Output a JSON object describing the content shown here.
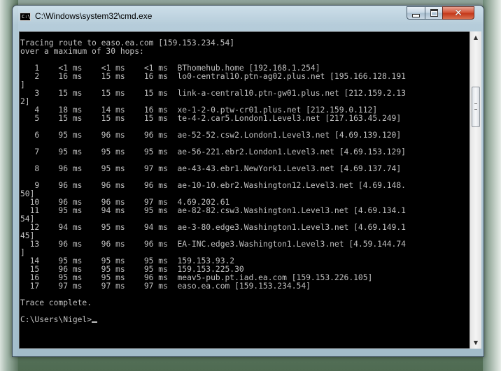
{
  "window": {
    "title": "C:\\Windows\\system32\\cmd.exe",
    "icon_text": "C:\\",
    "close_glyph": "✕"
  },
  "console": {
    "header_lines": [
      "Tracing route to easo.ea.com [159.153.234.54]",
      "over a maximum of 30 hops:"
    ],
    "hops": [
      {
        "n": "1",
        "t1": "<1 ms",
        "t2": "<1 ms",
        "t3": "<1 ms",
        "host": "BThomehub.home [192.168.1.254]"
      },
      {
        "n": "2",
        "t1": "16 ms",
        "t2": "15 ms",
        "t3": "16 ms",
        "host": "lo0-central10.ptn-ag02.plus.net [195.166.128.191",
        "cont": "]"
      },
      {
        "n": "3",
        "t1": "15 ms",
        "t2": "15 ms",
        "t3": "15 ms",
        "host": "link-a-central10.ptn-gw01.plus.net [212.159.2.13",
        "cont": "2]"
      },
      {
        "n": "4",
        "t1": "18 ms",
        "t2": "14 ms",
        "t3": "16 ms",
        "host": "xe-1-2-0.ptw-cr01.plus.net [212.159.0.112]"
      },
      {
        "n": "5",
        "t1": "15 ms",
        "t2": "15 ms",
        "t3": "15 ms",
        "host": "te-4-2.car5.London1.Level3.net [217.163.45.249]",
        "cont": ""
      },
      {
        "n": "6",
        "t1": "95 ms",
        "t2": "96 ms",
        "t3": "96 ms",
        "host": "ae-52-52.csw2.London1.Level3.net [4.69.139.120]",
        "cont": ""
      },
      {
        "n": "7",
        "t1": "95 ms",
        "t2": "95 ms",
        "t3": "95 ms",
        "host": "ae-56-221.ebr2.London1.Level3.net [4.69.153.129]",
        "cont": ""
      },
      {
        "n": "8",
        "t1": "96 ms",
        "t2": "95 ms",
        "t3": "97 ms",
        "host": "ae-43-43.ebr1.NewYork1.Level3.net [4.69.137.74]",
        "cont": ""
      },
      {
        "n": "9",
        "t1": "96 ms",
        "t2": "96 ms",
        "t3": "96 ms",
        "host": "ae-10-10.ebr2.Washington12.Level3.net [4.69.148.",
        "cont": "50]"
      },
      {
        "n": "10",
        "t1": "96 ms",
        "t2": "96 ms",
        "t3": "97 ms",
        "host": "4.69.202.61"
      },
      {
        "n": "11",
        "t1": "95 ms",
        "t2": "94 ms",
        "t3": "95 ms",
        "host": "ae-82-82.csw3.Washington1.Level3.net [4.69.134.1",
        "cont": "54]"
      },
      {
        "n": "12",
        "t1": "94 ms",
        "t2": "95 ms",
        "t3": "94 ms",
        "host": "ae-3-80.edge3.Washington1.Level3.net [4.69.149.1",
        "cont": "45]"
      },
      {
        "n": "13",
        "t1": "96 ms",
        "t2": "96 ms",
        "t3": "96 ms",
        "host": "EA-INC.edge3.Washington1.Level3.net [4.59.144.74",
        "cont": "]"
      },
      {
        "n": "14",
        "t1": "95 ms",
        "t2": "95 ms",
        "t3": "95 ms",
        "host": "159.153.93.2"
      },
      {
        "n": "15",
        "t1": "96 ms",
        "t2": "95 ms",
        "t3": "95 ms",
        "host": "159.153.225.30"
      },
      {
        "n": "16",
        "t1": "95 ms",
        "t2": "95 ms",
        "t3": "96 ms",
        "host": "meav5-pub.pt.iad.ea.com [159.153.226.105]"
      },
      {
        "n": "17",
        "t1": "97 ms",
        "t2": "97 ms",
        "t3": "97 ms",
        "host": "easo.ea.com [159.153.234.54]"
      }
    ],
    "footer": "Trace complete.",
    "prompt": "C:\\Users\\Nigel>"
  },
  "scrollbar": {
    "up_glyph": "▲",
    "down_glyph": "▼"
  }
}
